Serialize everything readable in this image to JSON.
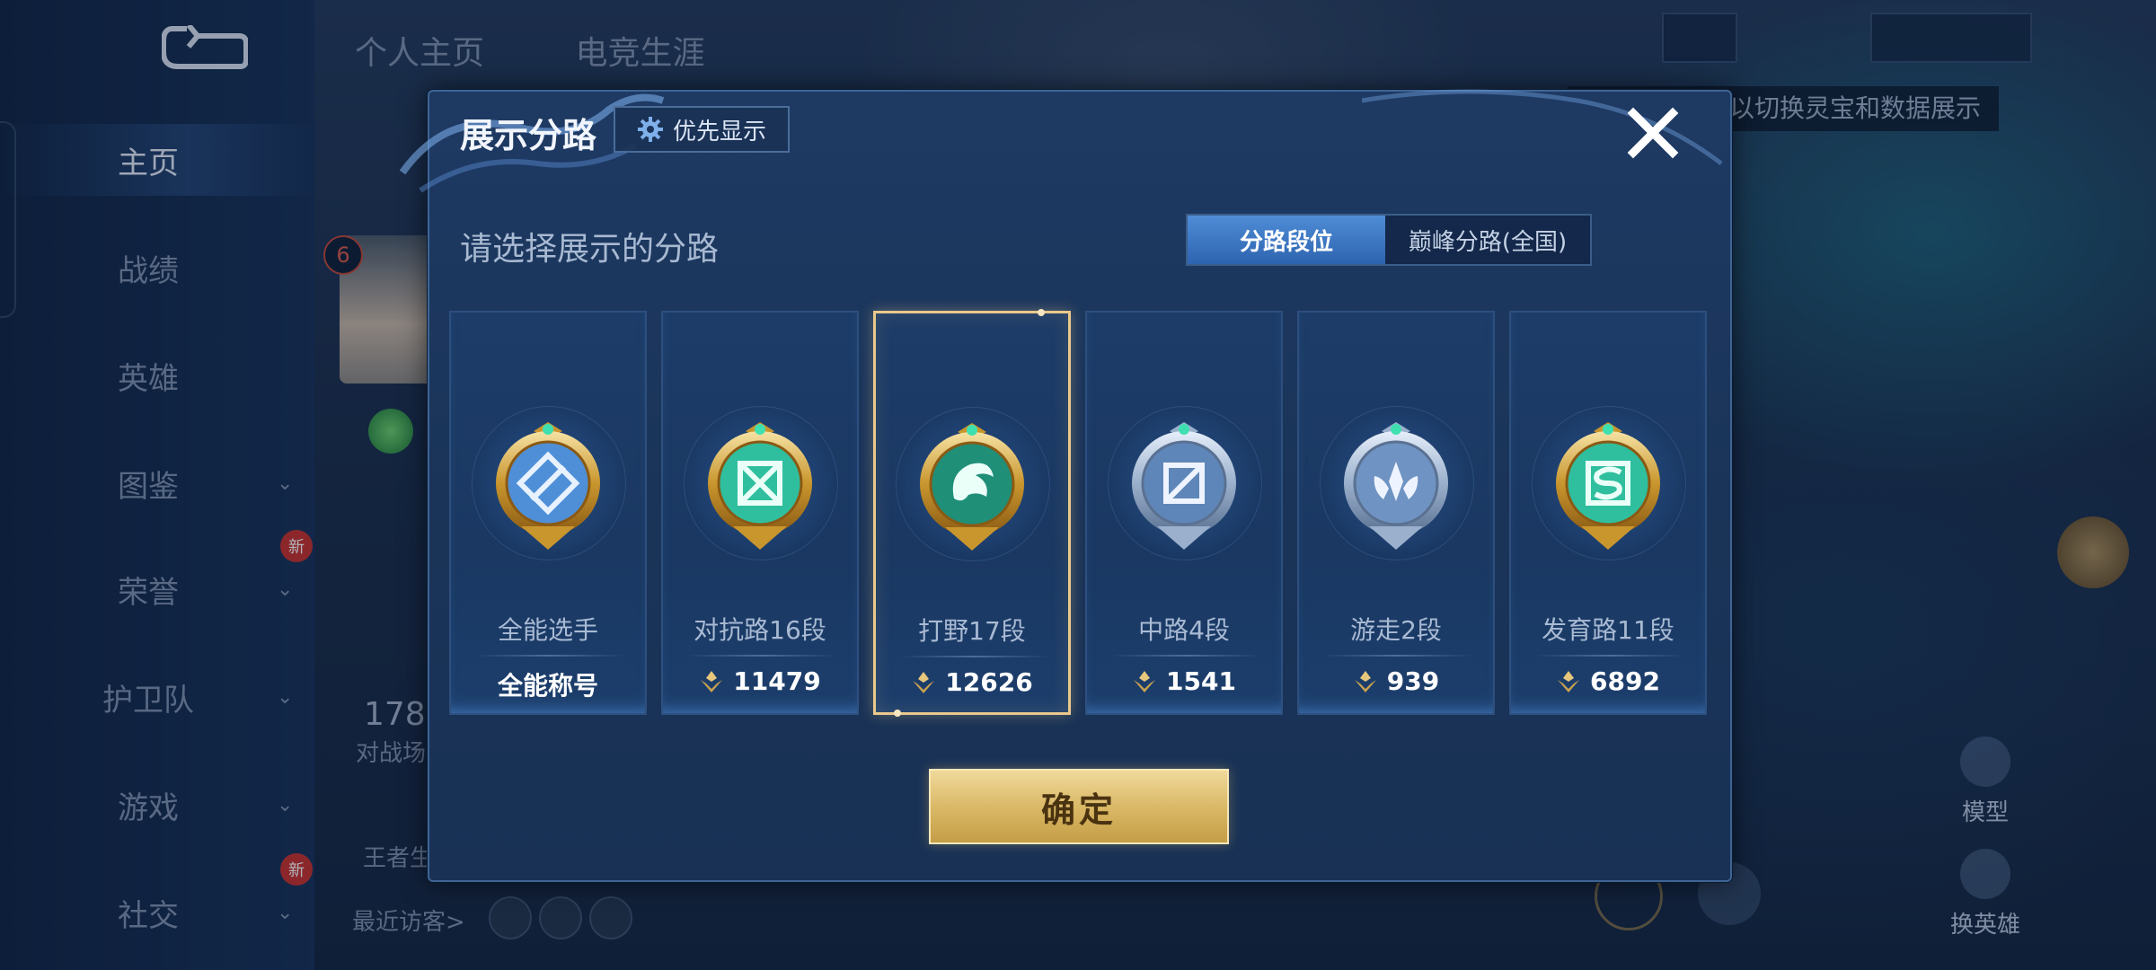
{
  "background": {
    "profile_tabs": [
      "个人主页",
      "电竞生涯"
    ],
    "nav_items": [
      {
        "label": "主页",
        "active": true,
        "chevron": false,
        "new": false
      },
      {
        "label": "战绩",
        "active": false,
        "chevron": false,
        "new": false
      },
      {
        "label": "英雄",
        "active": false,
        "chevron": false,
        "new": false
      },
      {
        "label": "图鉴",
        "active": false,
        "chevron": true,
        "new": false
      },
      {
        "label": "荣誉",
        "active": false,
        "chevron": true,
        "new": true
      },
      {
        "label": "护卫队",
        "active": false,
        "chevron": true,
        "new": false
      },
      {
        "label": "游戏",
        "active": false,
        "chevron": true,
        "new": false
      },
      {
        "label": "社交",
        "active": false,
        "chevron": true,
        "new": true
      }
    ],
    "new_badge": "新",
    "level": "6",
    "stat_number": "178",
    "stat_label": "对战场",
    "king_label": "王者生",
    "recent_visitors": "最近访客>",
    "tooltip": "以切换灵宝和数据展示",
    "model_label": "模型",
    "switch_hero_label": "换英雄"
  },
  "modal": {
    "title": "展示分路",
    "priority_button": "优先显示",
    "subtitle": "请选择展示的分路",
    "segment": {
      "active": "分路段位",
      "inactive": "巅峰分路(全国)"
    },
    "cards": [
      {
        "role": "全能选手",
        "value": "全能称号",
        "has_points_icon": false,
        "selected": false,
        "badge": "all-round",
        "rim": "gold",
        "core": "#4f8fd8"
      },
      {
        "role": "对抗路16段",
        "value": "11479",
        "has_points_icon": true,
        "selected": false,
        "badge": "clash-lane",
        "rim": "gold",
        "core": "#2fbf9e"
      },
      {
        "role": "打野17段",
        "value": "12626",
        "has_points_icon": true,
        "selected": true,
        "badge": "jungle",
        "rim": "gold",
        "core": "#1f8f78"
      },
      {
        "role": "中路4段",
        "value": "1541",
        "has_points_icon": true,
        "selected": false,
        "badge": "mid-lane",
        "rim": "silver",
        "core": "#5f86b8"
      },
      {
        "role": "游走2段",
        "value": "939",
        "has_points_icon": true,
        "selected": false,
        "badge": "roam",
        "rim": "silver",
        "core": "#6f93c2"
      },
      {
        "role": "发育路11段",
        "value": "6892",
        "has_points_icon": true,
        "selected": false,
        "badge": "farm-lane",
        "rim": "gold",
        "core": "#2fbf9e"
      }
    ],
    "confirm": "确定"
  },
  "colors": {
    "accent_gold": "#e9c98a",
    "tab_blue": "#3f78c4",
    "confirm_gold": "#d8b663"
  }
}
